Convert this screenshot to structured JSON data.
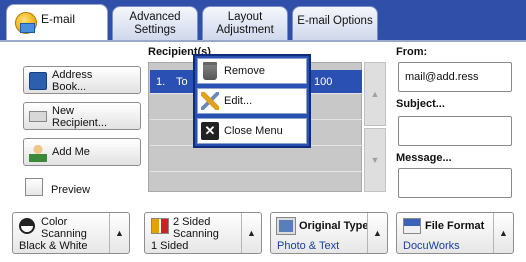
{
  "tabs": [
    {
      "label": "E-mail"
    },
    {
      "label": "Advanced\nSettings"
    },
    {
      "label": "Layout\nAdjustment"
    },
    {
      "label": "E-mail Options"
    }
  ],
  "left_buttons": {
    "address_book": "Address\nBook...",
    "new_recipient": "New\nRecipient...",
    "add_me": "Add Me",
    "preview": "Preview"
  },
  "recipients": {
    "label": "Recipient(s)",
    "rows": [
      {
        "num": "1.",
        "addr": "To",
        "tail": "100"
      }
    ]
  },
  "popup": {
    "remove": "Remove",
    "edit": "Edit...",
    "close": "Close Menu"
  },
  "right": {
    "from_label": "From:",
    "from_value": "mail@add.ress",
    "subject_label": "Subject...",
    "message_label": "Message..."
  },
  "bottom": {
    "color": {
      "title": "Color\nScanning",
      "value": "Black & White"
    },
    "sided": {
      "title": "2 Sided\nScanning",
      "value": "1 Sided"
    },
    "original": {
      "title": "Original Type",
      "value": "Photo & Text"
    },
    "format": {
      "title": "File Format",
      "value": "DocuWorks"
    }
  }
}
